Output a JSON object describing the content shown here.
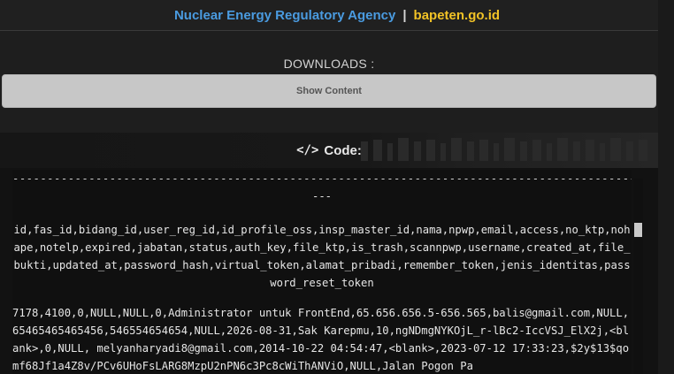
{
  "header": {
    "agency": "Nuclear Energy Regulatory Agency",
    "separator": "|",
    "site": "bapeten.go.id"
  },
  "downloads": {
    "label": "DOWNLOADS :",
    "button_label": "Show Content"
  },
  "code": {
    "icon": "code-icon",
    "title": "Code:",
    "background_text": "HYPHRATION",
    "dashes": "-------------------------------------------------------------------------------------------------------------",
    "dash_end": "---",
    "columns_text": "id,fas_id,bidang_id,user_reg_id,id_profile_oss,insp_master_id,nama,npwp,email,access,no_ktp,nohape,notelp,expired,jabatan,status,auth_key,file_ktp,is_trash,scannpwp,username,created_at,file_bukti,updated_at,password_hash,virtual_token,alamat_pribadi,remember_token,jenis_identitas,password_reset_token",
    "row_text": "7178,4100,0,NULL,NULL,0,Administrator untuk FrontEnd,65.656.656.5-656.565,balis@gmail.com,NULL,65465465465456,546554654654,NULL,2026-08-31,Sak Karepmu,10,ngNDmgNYKOjL_r-lBc2-IccVSJ_ElX2j,<blank>,0,NULL, melyanharyadi8@gmail.com,2014-10-22 04:54:47,<blank>,2023-07-12 17:33:23,$2y$13$qomf68Jf1a4Z8v/PCv6UHoFsLARG8MzpU2nPN6c3Pc8cWiThANViO,NULL,Jalan Pogon Pa"
  }
}
